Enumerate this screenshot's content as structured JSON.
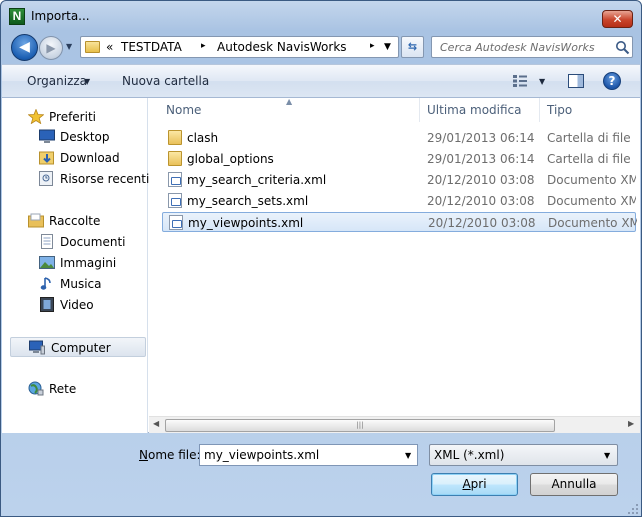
{
  "window": {
    "title": "Importa...",
    "close_glyph": "✕",
    "app_icon_letter": "N"
  },
  "address": {
    "overflow": "«",
    "crumbs": [
      "TESTDATA",
      "Autodesk NavisWorks"
    ],
    "separator": "▸"
  },
  "search": {
    "placeholder": "Cerca Autodesk NavisWorks"
  },
  "toolbar": {
    "organize_label": "Organizza",
    "new_folder_label": "Nuova cartella",
    "help_glyph": "?"
  },
  "sidebar": {
    "favorites": {
      "label": "Preferiti",
      "items": [
        {
          "label": "Desktop",
          "icon": "desktop-icon"
        },
        {
          "label": "Download",
          "icon": "download-folder-icon"
        },
        {
          "label": "Risorse recenti",
          "icon": "recent-places-icon"
        }
      ]
    },
    "libraries": {
      "label": "Raccolte",
      "items": [
        {
          "label": "Documenti",
          "icon": "documents-icon"
        },
        {
          "label": "Immagini",
          "icon": "pictures-icon"
        },
        {
          "label": "Musica",
          "icon": "music-icon"
        },
        {
          "label": "Video",
          "icon": "video-icon"
        }
      ]
    },
    "computer": {
      "label": "Computer"
    },
    "network": {
      "label": "Rete"
    }
  },
  "columns": {
    "name": "Nome",
    "modified": "Ultima modifica",
    "type": "Tipo"
  },
  "files": [
    {
      "name": "clash",
      "modified": "29/01/2013 06:14",
      "type": "Cartella di file",
      "kind": "folder"
    },
    {
      "name": "global_options",
      "modified": "29/01/2013 06:14",
      "type": "Cartella di file",
      "kind": "folder"
    },
    {
      "name": "my_search_criteria.xml",
      "modified": "20/12/2010 03:08",
      "type": "Documento XML",
      "kind": "xml"
    },
    {
      "name": "my_search_sets.xml",
      "modified": "20/12/2010 03:08",
      "type": "Documento XML",
      "kind": "xml"
    },
    {
      "name": "my_viewpoints.xml",
      "modified": "20/12/2010 03:08",
      "type": "Documento XML",
      "kind": "xml",
      "selected": true
    }
  ],
  "bottom": {
    "filename_label_prefix": "N",
    "filename_label_rest": "ome file:",
    "filename_value": "my_viewpoints.xml",
    "filetype_value": "XML (*.xml)",
    "open_label_prefix": "A",
    "open_label_rest": "pri",
    "cancel_label": "Annulla"
  },
  "colors": {
    "selection_border": "#84acdd",
    "title_close": "#c9452c",
    "accent_blue": "#1c5fb3"
  }
}
